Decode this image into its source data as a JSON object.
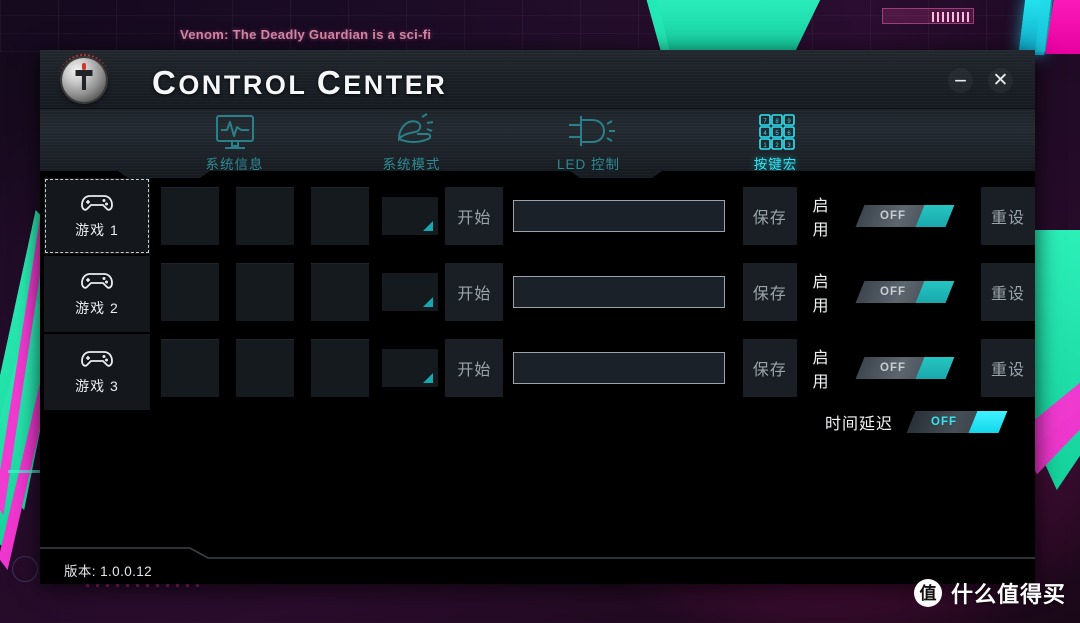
{
  "wallpaper": {
    "movie_caption": "Venom: The Deadly Guardian is a sci-fi",
    "watermark_badge": "值",
    "watermark_text": "什么值得买",
    "accent_green": "#2ef2bb",
    "accent_magenta": "#ef3acf",
    "accent_cyan": "#25e8f0"
  },
  "app": {
    "title_part1": "C",
    "title_part2": "ONTROL ",
    "title_part3": "C",
    "title_part4": "ENTER",
    "logo_icon": "helmet-logo-icon",
    "window_controls": {
      "minimize": "−",
      "minimize_icon": "minimize-icon",
      "close": "✕",
      "close_icon": "close-icon"
    },
    "accent": "#2fe4f5"
  },
  "tabs": [
    {
      "label": "系统信息",
      "icon": "monitor-pulse-icon",
      "active": false
    },
    {
      "label": "系统模式",
      "icon": "fan-power-icon",
      "active": false
    },
    {
      "label": "LED 控制",
      "icon": "led-bulb-icon",
      "active": false
    },
    {
      "label": "按键宏",
      "icon": "keypad-icon",
      "active": true
    }
  ],
  "sidebar": {
    "items": [
      {
        "label": "游戏 1",
        "icon": "gamepad-icon",
        "selected": true
      },
      {
        "label": "游戏 2",
        "icon": "gamepad-icon",
        "selected": false
      },
      {
        "label": "游戏 3",
        "icon": "gamepad-icon",
        "selected": false
      }
    ]
  },
  "rows": [
    {
      "slots": [
        "",
        "",
        ""
      ],
      "dropdown_value": "",
      "start_label": "开始",
      "macro_value": "",
      "macro_placeholder": "",
      "save_label": "保存",
      "enable_label": "启用",
      "toggle_state": "OFF",
      "reset_label": "重设"
    },
    {
      "slots": [
        "",
        "",
        ""
      ],
      "dropdown_value": "",
      "start_label": "开始",
      "macro_value": "",
      "macro_placeholder": "",
      "save_label": "保存",
      "enable_label": "启用",
      "toggle_state": "OFF",
      "reset_label": "重设"
    },
    {
      "slots": [
        "",
        "",
        ""
      ],
      "dropdown_value": "",
      "start_label": "开始",
      "macro_value": "",
      "macro_placeholder": "",
      "save_label": "保存",
      "enable_label": "启用",
      "toggle_state": "OFF",
      "reset_label": "重设"
    }
  ],
  "delay": {
    "label": "时间延迟",
    "toggle_state": "OFF"
  },
  "footer": {
    "version": "版本: 1.0.0.12"
  }
}
